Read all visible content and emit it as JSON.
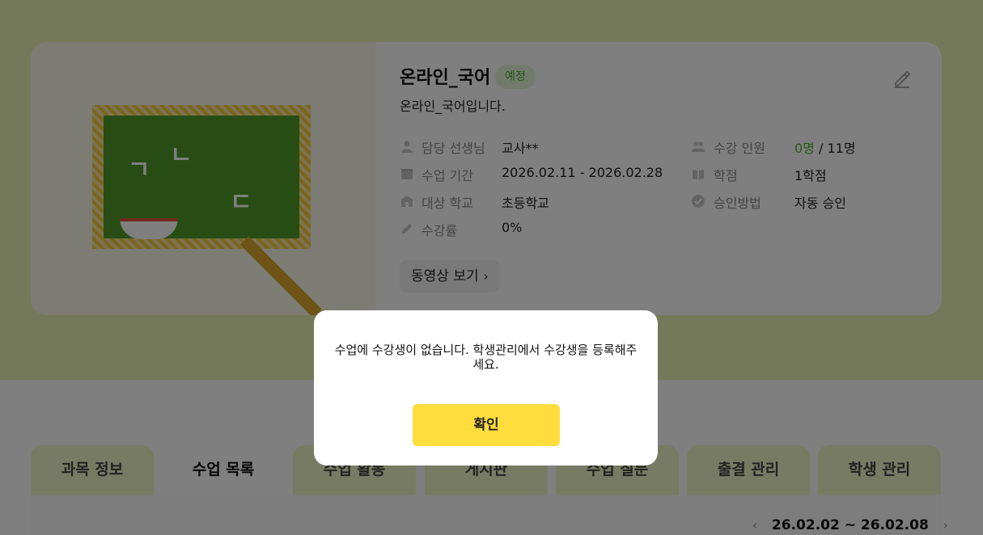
{
  "course": {
    "title": "온라인_국어",
    "status": "예정",
    "description": "온라인_국어입니다.",
    "thumbnail_glyphs": [
      "ㄱ",
      "ㄴ",
      "ㄷ"
    ],
    "info_left": [
      {
        "label": "담당 선생님",
        "value": "교사**",
        "icon": "person-icon"
      },
      {
        "label": "수업 기간",
        "value": "2026.02.11 - 2026.02.28",
        "icon": "calendar-icon"
      },
      {
        "label": "대상 학교",
        "value": "초등학교",
        "icon": "school-icon"
      },
      {
        "label": "수강률",
        "value": "0%",
        "icon": "pencil-icon"
      }
    ],
    "info_right": [
      {
        "label": "수강 인원",
        "value_current": "0명",
        "value_total": " / 11명",
        "icon": "people-icon"
      },
      {
        "label": "학점",
        "value": "1학점",
        "icon": "book-icon"
      },
      {
        "label": "승인방법",
        "value": "자동 승인",
        "icon": "check-circle-icon"
      }
    ],
    "video_button": "동영상 보기",
    "chevron_glyph": "›"
  },
  "tabs": [
    {
      "label": "과목 정보",
      "active": false
    },
    {
      "label": "수업 목록",
      "active": true
    },
    {
      "label": "수업 활동",
      "active": false
    },
    {
      "label": "게시판",
      "active": false
    },
    {
      "label": "수업 질문",
      "active": false
    },
    {
      "label": "출결 관리",
      "active": false
    },
    {
      "label": "학생 관리",
      "active": false
    }
  ],
  "week_nav": {
    "prev": "‹",
    "range": "26.02.02 ~ 26.02.08",
    "next": "›"
  },
  "modal": {
    "message": "수업에 수강생이 없습니다. 학생관리에서 수강생을 등록해주세요.",
    "confirm": "확인"
  },
  "colors": {
    "accent_yellow": "#ffdd3d",
    "brand_green": "#4fae2d",
    "header_bg": "#e6f3b2"
  }
}
